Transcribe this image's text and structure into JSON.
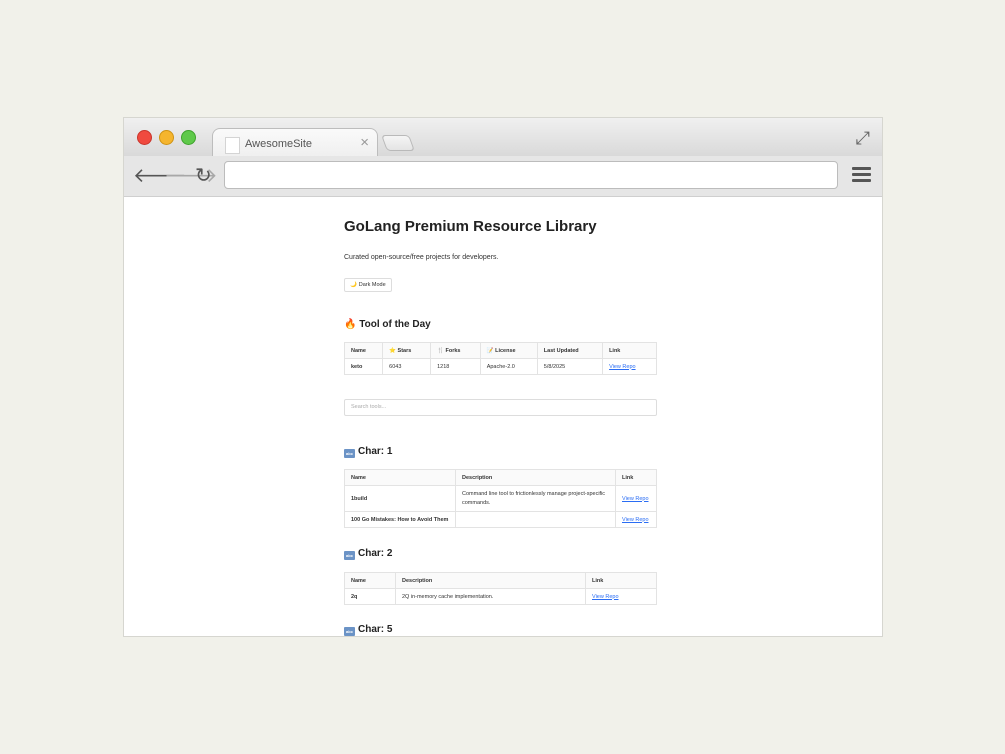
{
  "browser": {
    "tab_title": "AwesomeSite",
    "tab_close": "×",
    "url": ""
  },
  "page": {
    "title": "GoLang Premium Resource Library",
    "subtitle": "Curated open-source/free projects for developers.",
    "dark_mode_label": "🌙 Dark Mode",
    "search_placeholder": "Search tools..."
  },
  "tool_of_day": {
    "heading": "🔥 Tool of the Day",
    "headers": [
      "Name",
      "⭐ Stars",
      "🍴 Forks",
      "📝 License",
      "Last Updated",
      "Link"
    ],
    "row": [
      "keto",
      "6043",
      "1218",
      "Apache-2.0",
      "5/8/2025",
      "View Repo"
    ]
  },
  "sections": [
    {
      "heading": "Char: 1",
      "headers": [
        "Name",
        "Description",
        "Link"
      ],
      "rows": [
        [
          "1build",
          "Command line tool to frictionlessly manage project-specific commands.",
          "View Repo"
        ],
        [
          "100 Go Mistakes: How to Avoid Them",
          "",
          "View Repo"
        ]
      ]
    },
    {
      "heading": "Char: 2",
      "headers": [
        "Name",
        "Description",
        "Link"
      ],
      "rows": [
        [
          "2q",
          "2Q in-memory cache implementation.",
          "View Repo"
        ]
      ]
    },
    {
      "heading": "Char: 5"
    }
  ]
}
